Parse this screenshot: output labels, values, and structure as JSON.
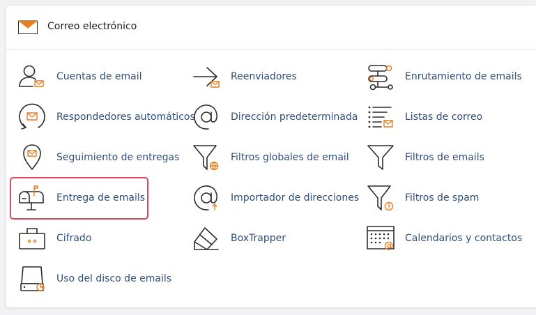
{
  "header": {
    "title": "Correo electrónico",
    "icon": "envelope-icon"
  },
  "colors": {
    "accent": "#e67e22",
    "link": "#2f4e7a",
    "highlight": "#e0455d"
  },
  "items": [
    {
      "label": "Cuentas de email",
      "icon": "user-email-icon"
    },
    {
      "label": "Reenviadores",
      "icon": "forward-arrow-icon"
    },
    {
      "label": "Enrutamiento de emails",
      "icon": "routing-icon"
    },
    {
      "label": "Respondedores automáticos",
      "icon": "autoresponder-icon"
    },
    {
      "label": "Dirección predeterminada",
      "icon": "at-sign-icon"
    },
    {
      "label": "Listas de correo",
      "icon": "mailing-list-icon"
    },
    {
      "label": "Seguimiento de entregas",
      "icon": "map-pin-email-icon"
    },
    {
      "label": "Filtros globales de email",
      "icon": "filter-globe-icon"
    },
    {
      "label": "Filtros de emails",
      "icon": "filter-icon"
    },
    {
      "label": "Entrega de emails",
      "icon": "mailbox-icon"
    },
    {
      "label": "Importador de direcciones",
      "icon": "at-import-icon"
    },
    {
      "label": "Filtros de spam",
      "icon": "filter-alert-icon"
    },
    {
      "label": "Cifrado",
      "icon": "briefcase-lock-icon"
    },
    {
      "label": "BoxTrapper",
      "icon": "boxtrapper-icon"
    },
    {
      "label": "Calendarios y contactos",
      "icon": "calendar-at-icon"
    },
    {
      "label": "Uso del disco de emails",
      "icon": "disk-usage-icon"
    }
  ]
}
